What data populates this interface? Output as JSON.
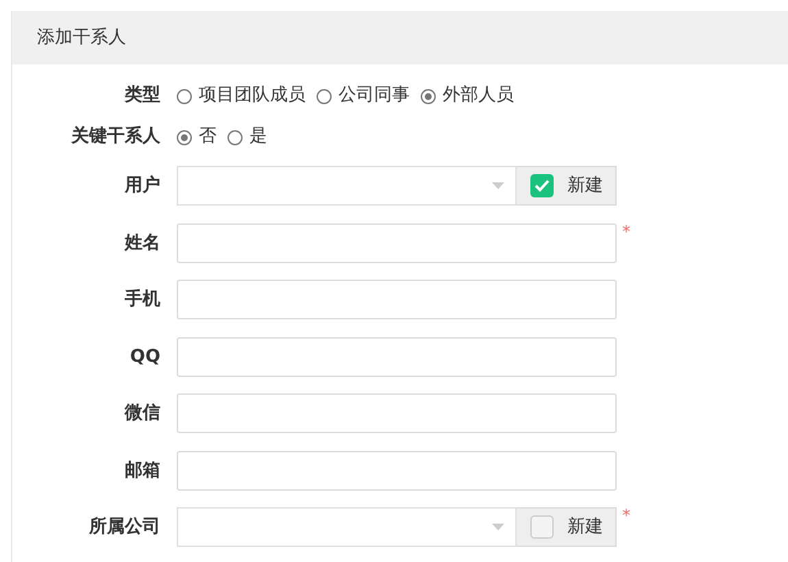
{
  "panel": {
    "title": "添加干系人"
  },
  "rows": [
    {
      "kind": "radio",
      "label": "类型",
      "options": [
        {
          "label": "项目团队成员",
          "selected": false
        },
        {
          "label": "公司同事",
          "selected": false
        },
        {
          "label": "外部人员",
          "selected": true
        }
      ]
    },
    {
      "kind": "radio",
      "label": "关键干系人",
      "options": [
        {
          "label": "否",
          "selected": true
        },
        {
          "label": "是",
          "selected": false
        }
      ]
    },
    {
      "kind": "select",
      "label": "用户",
      "required": false,
      "new_button": {
        "label": "新建",
        "checked": true
      }
    },
    {
      "kind": "text",
      "label": "姓名",
      "required": true
    },
    {
      "kind": "text",
      "label": "手机",
      "required": false
    },
    {
      "kind": "text",
      "label": "QQ",
      "required": false
    },
    {
      "kind": "text",
      "label": "微信",
      "required": false
    },
    {
      "kind": "text",
      "label": "邮箱",
      "required": false
    },
    {
      "kind": "select",
      "label": "所属公司",
      "required": true,
      "new_button": {
        "label": "新建",
        "checked": false
      }
    }
  ],
  "required_mark": "*"
}
